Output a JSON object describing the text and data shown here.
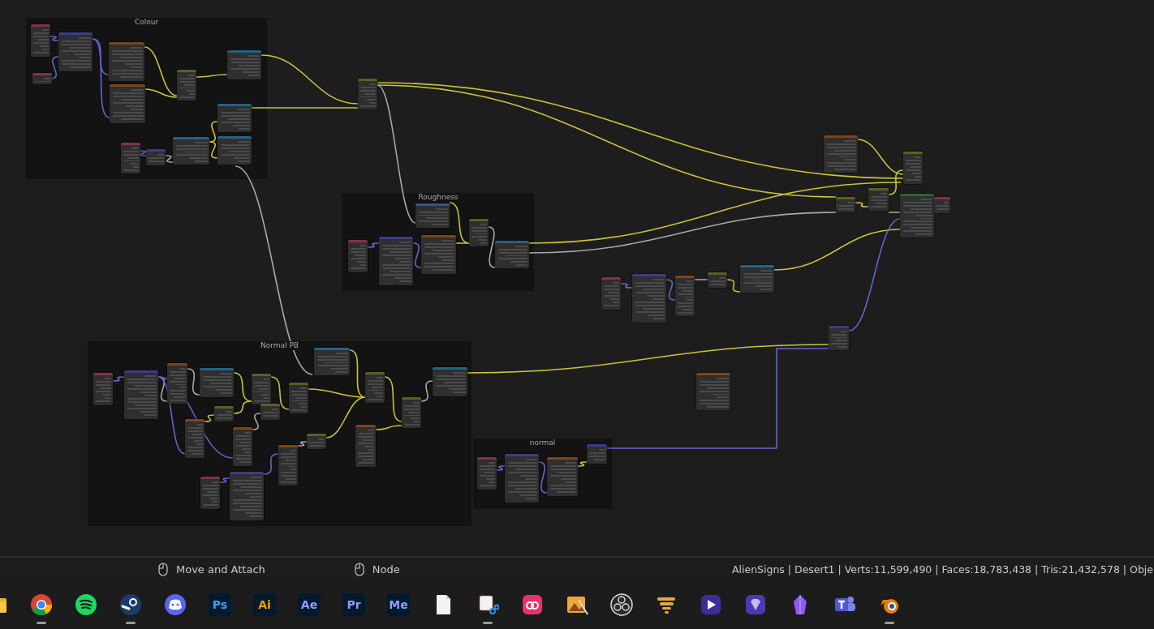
{
  "frames": [
    {
      "title": "Colour",
      "nodes": [
        {
          "kind": "input"
        },
        {
          "kind": "input"
        },
        {
          "kind": "vector"
        },
        {
          "kind": "texture"
        },
        {
          "kind": "texture"
        },
        {
          "kind": "mix"
        },
        {
          "kind": "converter"
        },
        {
          "kind": "converter"
        },
        {
          "kind": "converter"
        },
        {
          "kind": "input"
        },
        {
          "kind": "vector"
        },
        {
          "kind": "converter"
        }
      ]
    },
    {
      "title": "Roughness",
      "nodes": [
        {
          "kind": "converter"
        },
        {
          "kind": "input"
        },
        {
          "kind": "vector"
        },
        {
          "kind": "texture"
        },
        {
          "kind": "mix"
        },
        {
          "kind": "converter"
        }
      ]
    },
    {
      "title": "Normal PB",
      "nodes": [
        {
          "kind": "input"
        },
        {
          "kind": "vector"
        },
        {
          "kind": "texture"
        },
        {
          "kind": "converter"
        },
        {
          "kind": "mix"
        },
        {
          "kind": "mix"
        },
        {
          "kind": "texture"
        },
        {
          "kind": "texture"
        },
        {
          "kind": "mix"
        },
        {
          "kind": "mix"
        },
        {
          "kind": "converter"
        },
        {
          "kind": "mix"
        },
        {
          "kind": "texture"
        },
        {
          "kind": "mix"
        },
        {
          "kind": "texture"
        },
        {
          "kind": "mix"
        },
        {
          "kind": "converter"
        },
        {
          "kind": "input"
        },
        {
          "kind": "vector"
        }
      ]
    },
    {
      "title": "normal",
      "nodes": [
        {
          "kind": "input"
        },
        {
          "kind": "vector"
        },
        {
          "kind": "texture"
        },
        {
          "kind": "vector"
        }
      ]
    }
  ],
  "nodes": [
    {
      "kind": "mix"
    },
    {
      "kind": "texture"
    },
    {
      "kind": "mix"
    },
    {
      "kind": "mix"
    },
    {
      "kind": "mix"
    },
    {
      "kind": "shader"
    },
    {
      "kind": "input"
    },
    {
      "kind": "input"
    },
    {
      "kind": "vector"
    },
    {
      "kind": "texture"
    },
    {
      "kind": "mix"
    },
    {
      "kind": "converter"
    },
    {
      "kind": "vector"
    },
    {
      "kind": "texture"
    }
  ],
  "status_bar": {
    "hints": [
      "Move and Attach",
      "Node"
    ],
    "stats": "AlienSigns | Desert1 | Verts:11,599,490 | Faces:18,783,438 | Tris:21,432,578 | Obje"
  },
  "taskbar": [
    {
      "kind": "folder",
      "running": false
    },
    {
      "kind": "chrome",
      "running": true
    },
    {
      "kind": "spotify",
      "running": false
    },
    {
      "kind": "steam",
      "running": true
    },
    {
      "kind": "discord",
      "running": false
    },
    {
      "kind": "adobe",
      "label": "Ps",
      "color": "#31a8ff",
      "running": false
    },
    {
      "kind": "adobe",
      "label": "Ai",
      "color": "#ff9a00",
      "running": false
    },
    {
      "kind": "adobe",
      "label": "Ae",
      "color": "#9999ff",
      "running": false
    },
    {
      "kind": "adobe",
      "label": "Pr",
      "color": "#9999ff",
      "running": false
    },
    {
      "kind": "adobe",
      "label": "Me",
      "color": "#9999ff",
      "running": false
    },
    {
      "kind": "file",
      "running": false
    },
    {
      "kind": "snip",
      "running": true
    },
    {
      "kind": "cloud",
      "running": false
    },
    {
      "kind": "photo",
      "running": false
    },
    {
      "kind": "obs",
      "running": false
    },
    {
      "kind": "tornado",
      "running": false
    },
    {
      "kind": "play",
      "running": false
    },
    {
      "kind": "gem",
      "running": false
    },
    {
      "kind": "crystal",
      "running": false
    },
    {
      "kind": "teams",
      "running": false
    },
    {
      "kind": "blender",
      "running": true
    }
  ]
}
